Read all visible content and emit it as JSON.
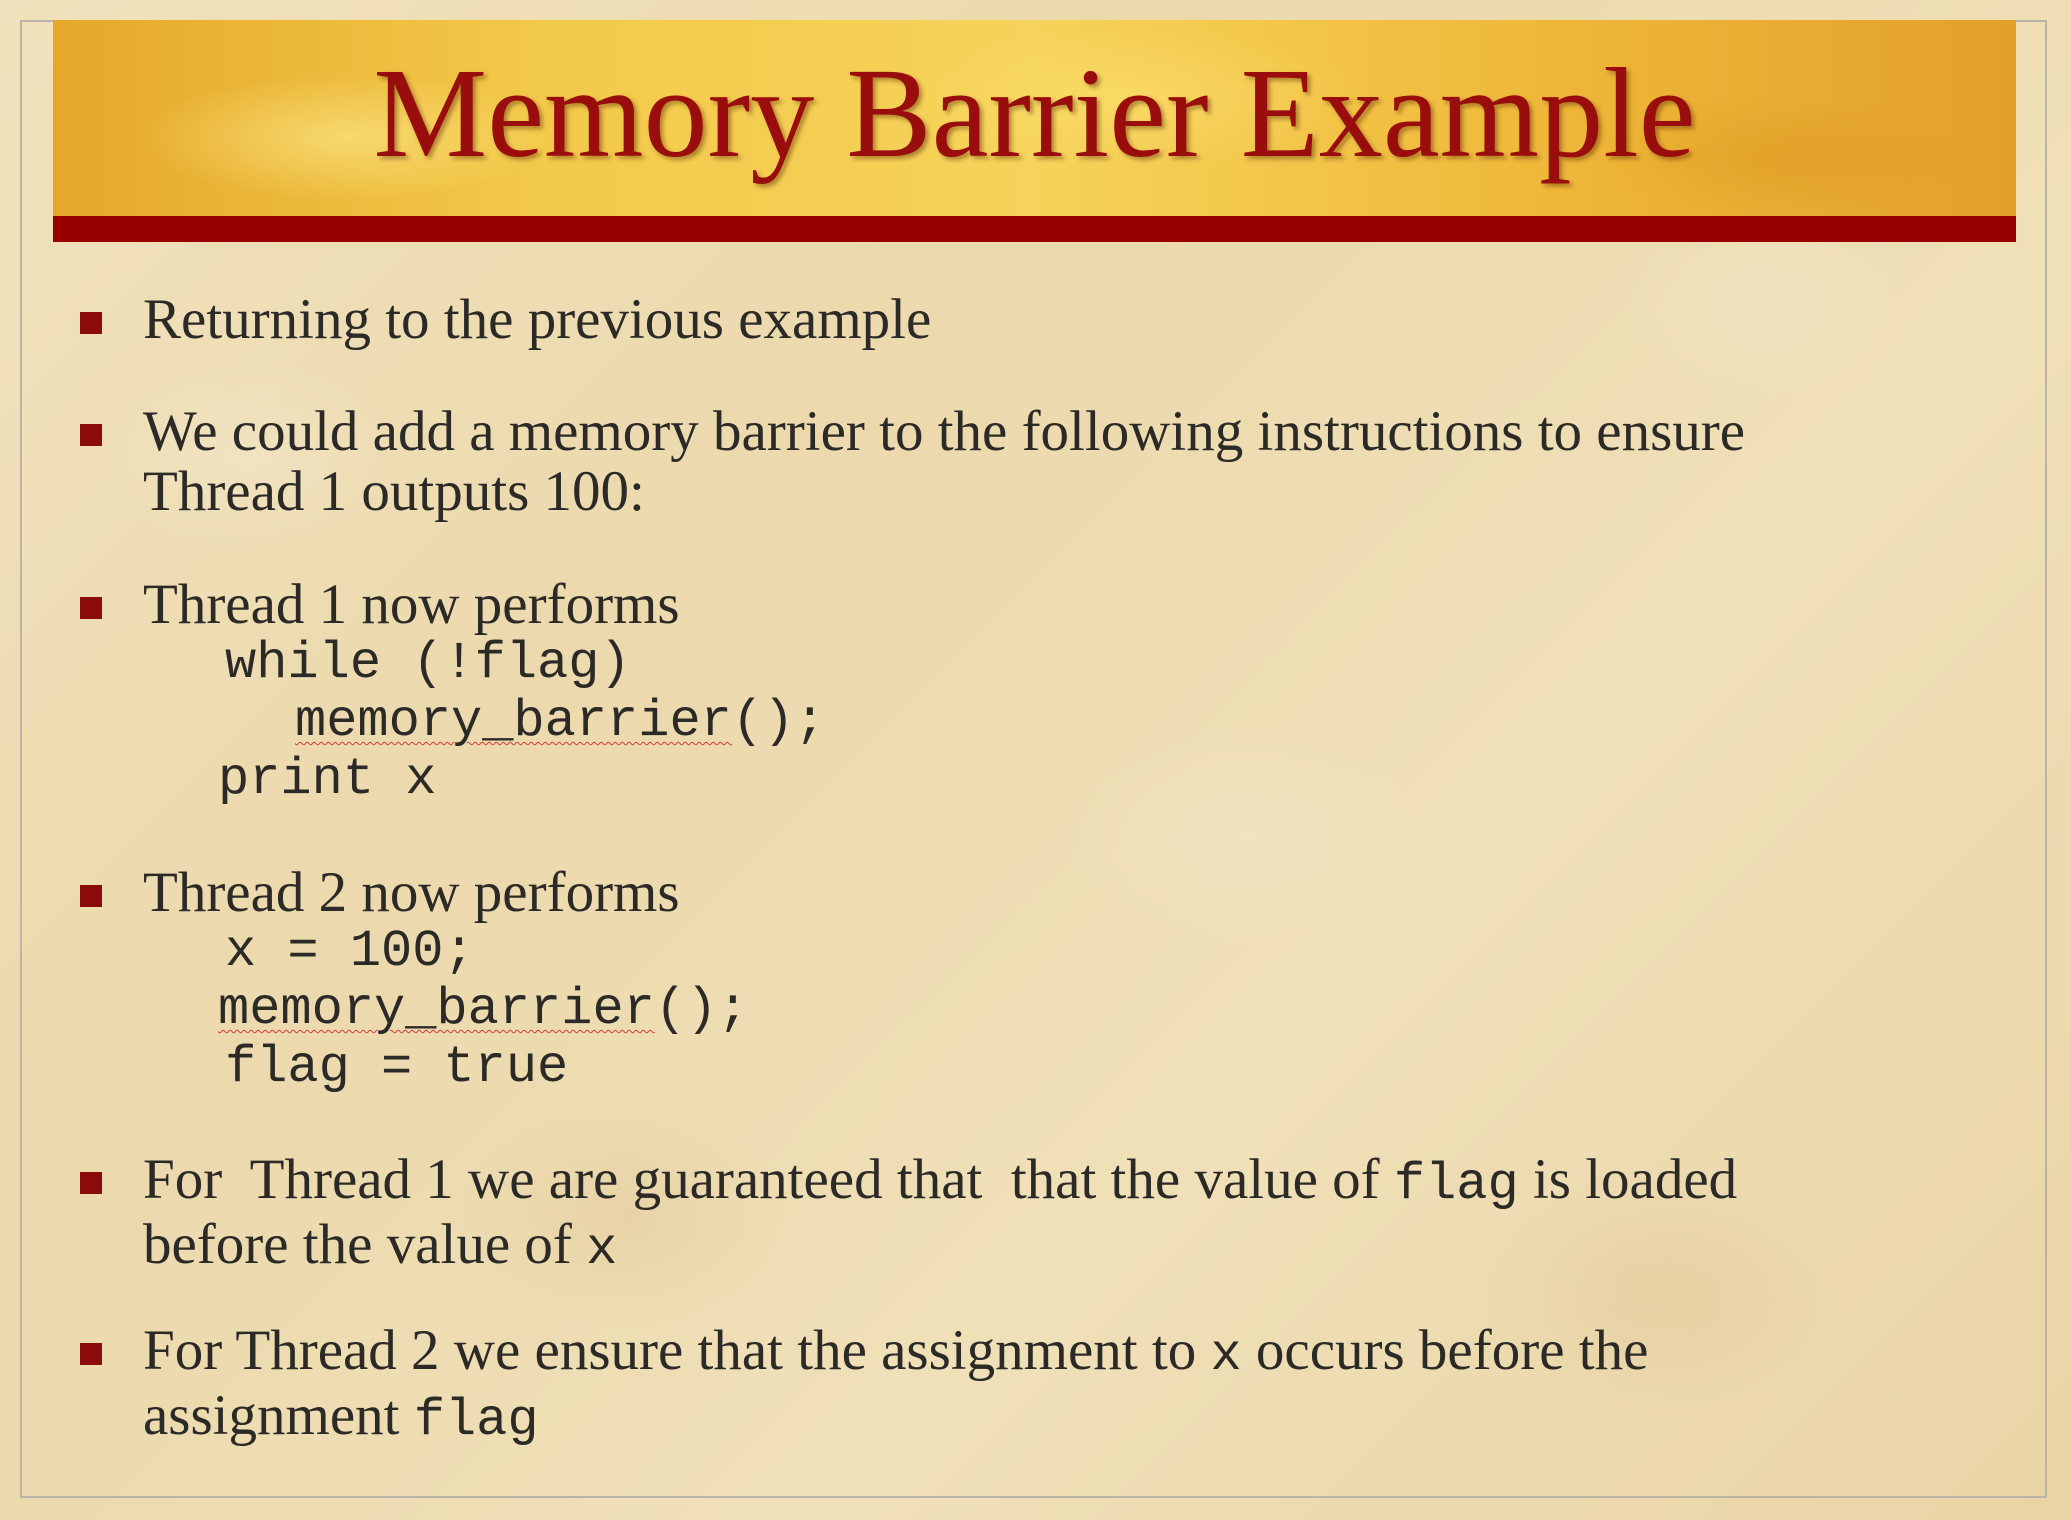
{
  "slide": {
    "title": "Memory Barrier Example",
    "colors": {
      "title_text": "#9a0d0d",
      "title_rule": "#990000",
      "bullet_marker": "#8b0a0a",
      "body_text": "#2b2a26"
    },
    "bullets": [
      {
        "text": "Returning to the previous example"
      },
      {
        "line1": "We could add a memory barrier to the following instructions to ensure",
        "line2": "Thread 1 outputs 100:"
      },
      {
        "text": "Thread 1 now performs",
        "code": {
          "line1": "while (!flag)",
          "line2_fn": "memory_barrier",
          "line2_rest": "();",
          "line3": "print x"
        }
      },
      {
        "text": "Thread 2 now performs",
        "code": {
          "line1": "x = 100;",
          "line2_fn": "memory_barrier",
          "line2_rest": "();",
          "line3": "flag = true"
        }
      },
      {
        "line1_a": "For  Thread 1 we are guaranteed that  that the value of ",
        "line1_code": "flag",
        "line1_b": " is loaded",
        "line2_a": "before the value of ",
        "line2_code": "x"
      },
      {
        "line1_a": "For Thread 2 we ensure that the assignment to ",
        "line1_code": "x",
        "line1_b": " occurs before the",
        "line2_a": "assignment ",
        "line2_code": "flag"
      }
    ]
  }
}
